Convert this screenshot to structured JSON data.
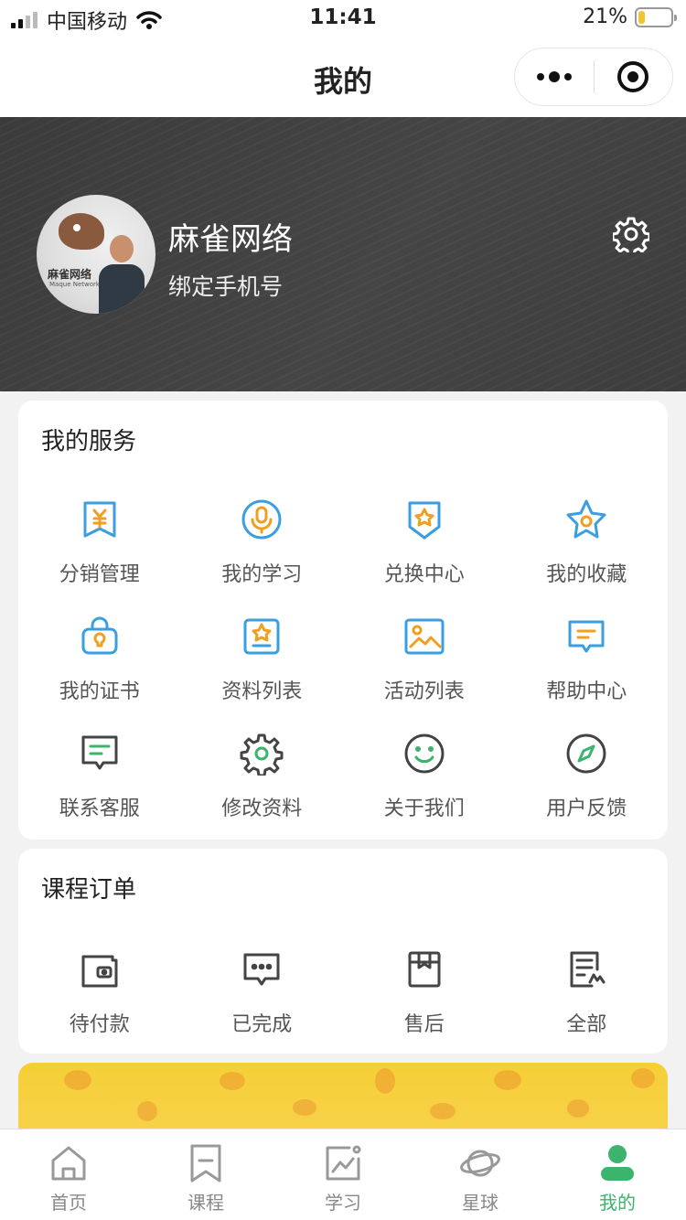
{
  "status_bar": {
    "carrier": "中国移动",
    "time": "11:41",
    "battery_percent": "21%",
    "battery_level": 0.21
  },
  "nav": {
    "title": "我的"
  },
  "profile": {
    "name": "麻雀网络",
    "bind_phone": "绑定手机号",
    "avatar_brand": "麻雀网络",
    "avatar_brand_sub": "Maque Network"
  },
  "services": {
    "title": "我的服务",
    "items": [
      {
        "label": "分销管理",
        "icon": "yuan-badge-icon"
      },
      {
        "label": "我的学习",
        "icon": "microphone-icon"
      },
      {
        "label": "兑换中心",
        "icon": "star-shield-icon"
      },
      {
        "label": "我的收藏",
        "icon": "star-icon"
      },
      {
        "label": "我的证书",
        "icon": "certificate-icon"
      },
      {
        "label": "资料列表",
        "icon": "star-card-icon"
      },
      {
        "label": "活动列表",
        "icon": "image-icon"
      },
      {
        "label": "帮助中心",
        "icon": "chat-bubble-icon"
      },
      {
        "label": "联系客服",
        "icon": "message-icon"
      },
      {
        "label": "修改资料",
        "icon": "gear-icon"
      },
      {
        "label": "关于我们",
        "icon": "smile-icon"
      },
      {
        "label": "用户反馈",
        "icon": "compass-icon"
      }
    ]
  },
  "orders": {
    "title": "课程订单",
    "items": [
      {
        "label": "待付款",
        "icon": "wallet-icon"
      },
      {
        "label": "已完成",
        "icon": "chat-dots-icon"
      },
      {
        "label": "售后",
        "icon": "box-icon"
      },
      {
        "label": "全部",
        "icon": "list-icon"
      }
    ]
  },
  "tabs": [
    {
      "label": "首页",
      "icon": "home-icon"
    },
    {
      "label": "课程",
      "icon": "bookmark-icon"
    },
    {
      "label": "学习",
      "icon": "chart-icon"
    },
    {
      "label": "星球",
      "icon": "planet-icon"
    },
    {
      "label": "我的",
      "icon": "user-icon",
      "active": true
    }
  ],
  "colors": {
    "blue": "#3a9ee0",
    "orange": "#f0a020",
    "green": "#3cb46e",
    "dark": "#444444",
    "promo": "#f6cf36"
  }
}
